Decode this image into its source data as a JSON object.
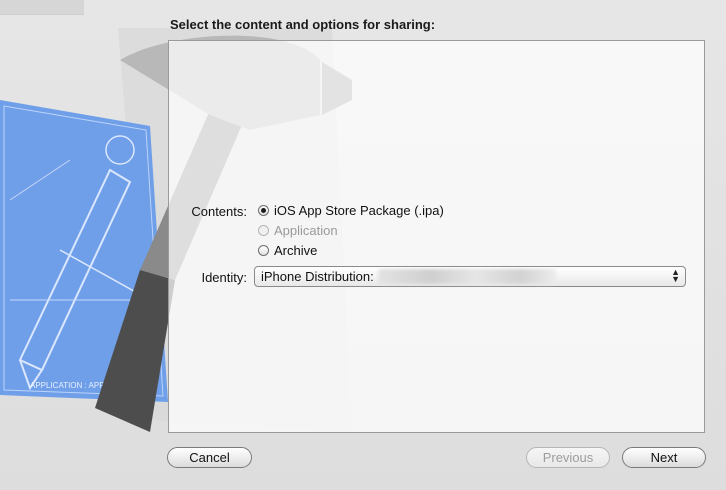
{
  "dialog": {
    "heading": "Select the content and options for sharing:"
  },
  "contents": {
    "label": "Contents:",
    "options": [
      {
        "label": "iOS App Store Package (.ipa)",
        "state": "selected"
      },
      {
        "label": "Application",
        "state": "disabled"
      },
      {
        "label": "Archive",
        "state": "enabled"
      }
    ]
  },
  "identity": {
    "label": "Identity:",
    "selected_value": "iPhone Distribution:"
  },
  "buttons": {
    "cancel": "Cancel",
    "previous": "Previous",
    "next": "Next"
  },
  "artwork": {
    "blueprint_text": "APPLICATION : APP"
  }
}
